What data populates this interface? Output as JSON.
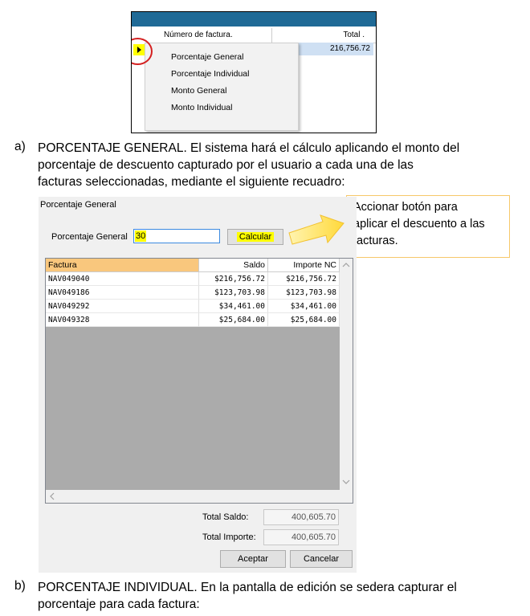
{
  "menu_screenshot": {
    "col_numero": "Número de factura.",
    "col_total": "Total .",
    "row_total": "216,756.72",
    "menu_items": [
      "Porcentaje General",
      "Porcentaje Individual",
      "Monto General",
      "Monto Individual"
    ]
  },
  "section_a": {
    "label": "a)",
    "lines": [
      "PORCENTAJE GENERAL. El sistema hará el cálculo aplicando el monto del",
      "porcentaje de descuento capturado por el usuario a cada una de las",
      "facturas seleccionadas, mediante el siguiente recuadro:"
    ]
  },
  "callout": {
    "lines": [
      "Accionar botón para",
      "aplicar el descuento a las",
      "facturas."
    ],
    "border_color": "#f6c86a"
  },
  "dialog": {
    "title": "Porcentaje General",
    "percent_label": "Porcentaje General",
    "percent_value": "30",
    "calc_button": "Calcular",
    "columns": [
      "Factura",
      "Saldo",
      "Importe NC"
    ],
    "rows": [
      [
        "NAV049040",
        "$216,756.72",
        "$216,756.72"
      ],
      [
        "NAV049186",
        "$123,703.98",
        "$123,703.98"
      ],
      [
        "NAV049292",
        "$34,461.00",
        "$34,461.00"
      ],
      [
        "NAV049328",
        "$25,684.00",
        "$25,684.00"
      ]
    ],
    "total_saldo_label": "Total Saldo:",
    "total_saldo_value": "400,605.70",
    "total_importe_label": "Total Importe:",
    "total_importe_value": "400,605.70",
    "accept_button": "Aceptar",
    "cancel_button": "Cancelar"
  },
  "section_b": {
    "label": "b)",
    "lines": [
      "PORCENTAJE INDIVIDUAL. En la pantalla de edición se sedera capturar el",
      "porcentaje para cada factura:"
    ]
  },
  "colors": {
    "header_blue": "#1f6a96",
    "highlight_yellow": "#ffff00",
    "circle_red": "#d42020",
    "selected_header": "#f9c77d"
  }
}
